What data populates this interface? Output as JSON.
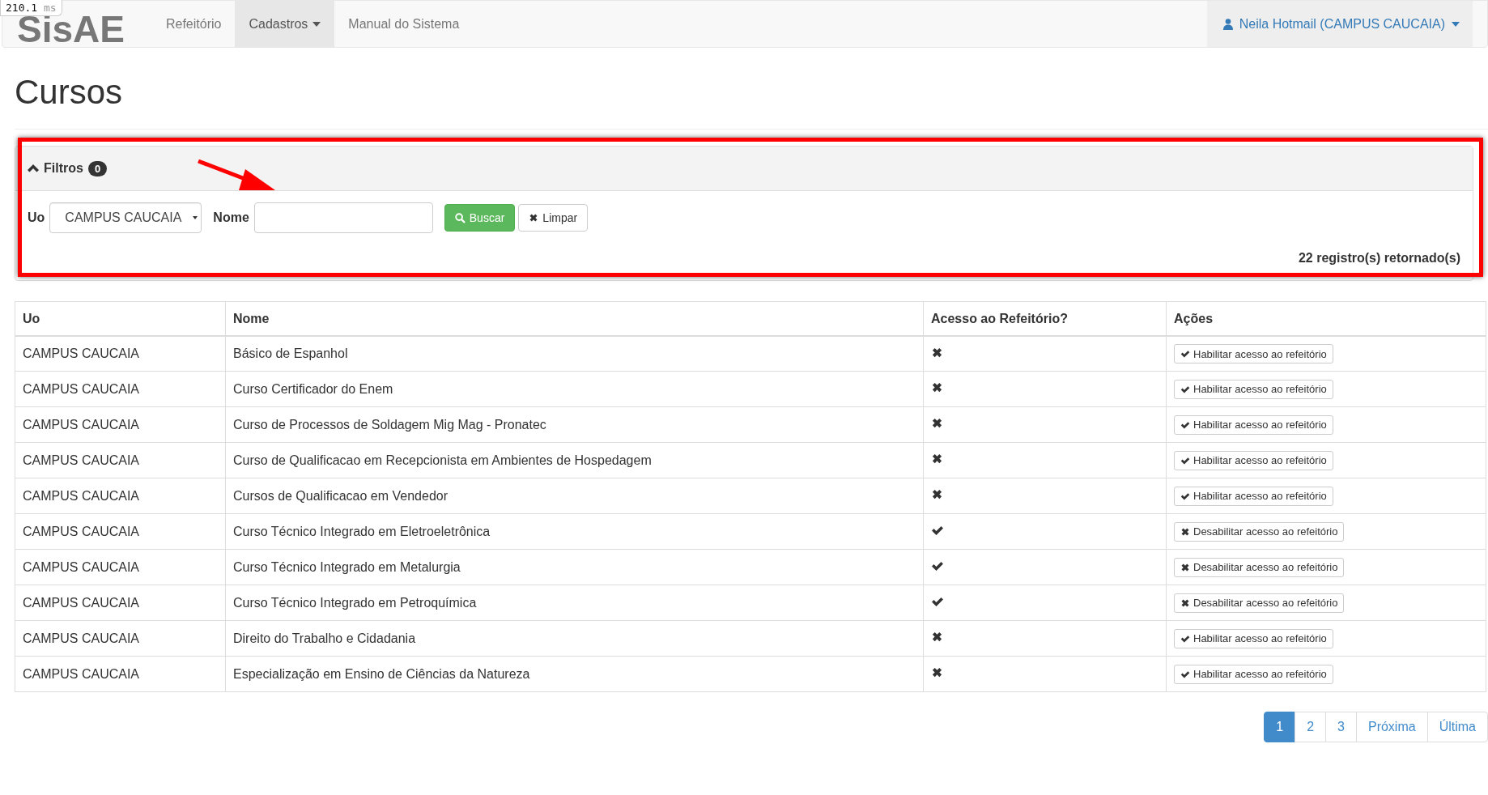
{
  "timing_badge": {
    "value": "210.1",
    "unit": "ms"
  },
  "navbar": {
    "brand": "SisAE",
    "items": [
      {
        "label": "Refeitório",
        "selected": false,
        "dropdown": false
      },
      {
        "label": "Cadastros",
        "selected": true,
        "dropdown": true
      },
      {
        "label": "Manual do Sistema",
        "selected": false,
        "dropdown": false
      }
    ],
    "user": "Neila Hotmail (CAMPUS CAUCAIA)"
  },
  "page_title": "Cursos",
  "filters": {
    "title": "Filtros",
    "count": "0",
    "expanded": true,
    "uo_label": "Uo",
    "uo_value": "CAMPUS CAUCAIA",
    "nome_label": "Nome",
    "search_button": "Buscar",
    "clear_button": "Limpar",
    "result_count": "22 registro(s) retornado(s)"
  },
  "table": {
    "columns": [
      "Uo",
      "Nome",
      "Acesso ao Refeitório?",
      "Ações"
    ],
    "rows": [
      {
        "uo": "CAMPUS CAUCAIA",
        "nome": "Básico de Espanhol",
        "access": false,
        "action": "Habilitar acesso ao refeitório"
      },
      {
        "uo": "CAMPUS CAUCAIA",
        "nome": "Curso Certificador do Enem",
        "access": false,
        "action": "Habilitar acesso ao refeitório"
      },
      {
        "uo": "CAMPUS CAUCAIA",
        "nome": "Curso de Processos de Soldagem Mig Mag - Pronatec",
        "access": false,
        "action": "Habilitar acesso ao refeitório"
      },
      {
        "uo": "CAMPUS CAUCAIA",
        "nome": "Curso de Qualificacao em Recepcionista em Ambientes de Hospedagem",
        "access": false,
        "action": "Habilitar acesso ao refeitório"
      },
      {
        "uo": "CAMPUS CAUCAIA",
        "nome": "Cursos de Qualificacao em Vendedor",
        "access": false,
        "action": "Habilitar acesso ao refeitório"
      },
      {
        "uo": "CAMPUS CAUCAIA",
        "nome": "Curso Técnico Integrado em Eletroeletrônica",
        "access": true,
        "action": "Desabilitar acesso ao refeitório"
      },
      {
        "uo": "CAMPUS CAUCAIA",
        "nome": "Curso Técnico Integrado em Metalurgia",
        "access": true,
        "action": "Desabilitar acesso ao refeitório"
      },
      {
        "uo": "CAMPUS CAUCAIA",
        "nome": "Curso Técnico Integrado em Petroquímica",
        "access": true,
        "action": "Desabilitar acesso ao refeitório"
      },
      {
        "uo": "CAMPUS CAUCAIA",
        "nome": "Direito do Trabalho e Cidadania",
        "access": false,
        "action": "Habilitar acesso ao refeitório"
      },
      {
        "uo": "CAMPUS CAUCAIA",
        "nome": "Especialização em Ensino de Ciências da Natureza",
        "access": false,
        "action": "Habilitar acesso ao refeitório"
      }
    ]
  },
  "pagination": [
    {
      "label": "1",
      "selected": true
    },
    {
      "label": "2",
      "selected": false
    },
    {
      "label": "3",
      "selected": false
    },
    {
      "label": "Próxima",
      "selected": false
    },
    {
      "label": "Última",
      "selected": false
    }
  ]
}
